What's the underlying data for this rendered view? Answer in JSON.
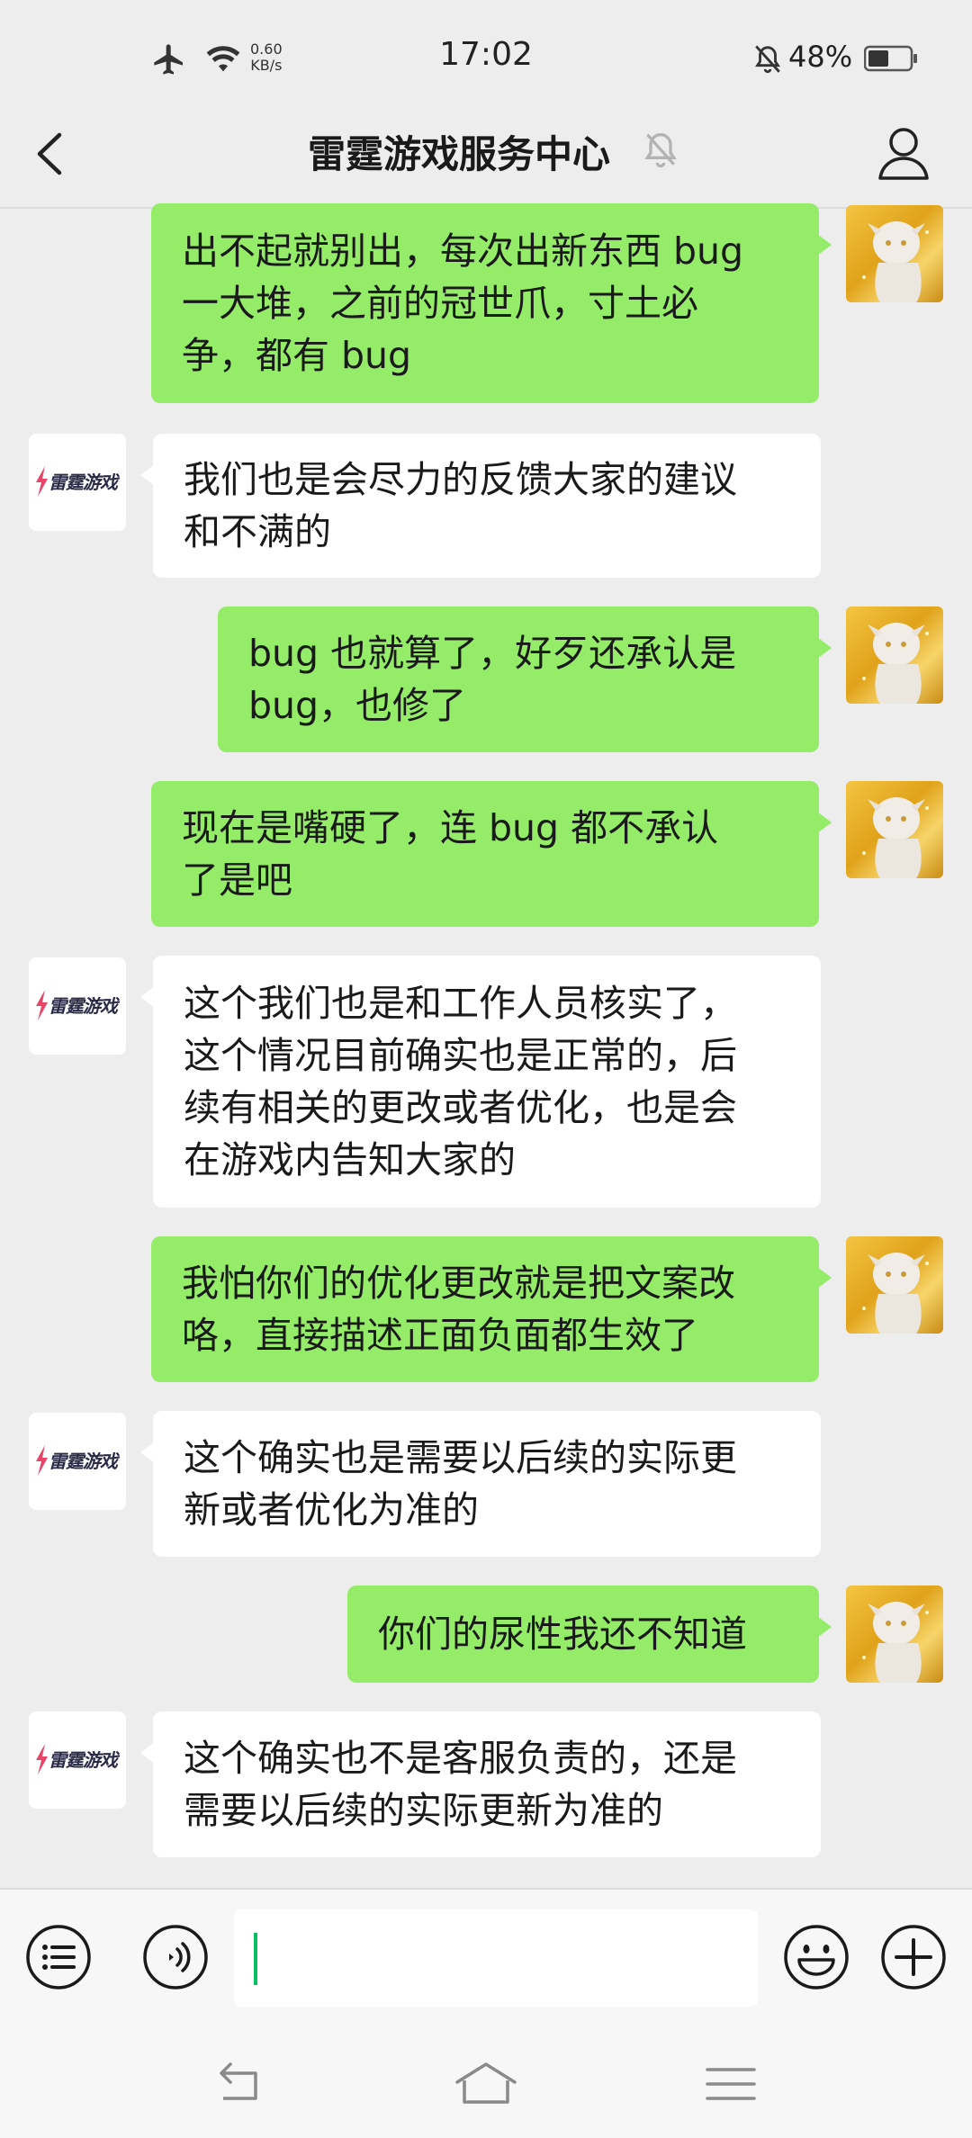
{
  "status_bar": {
    "time": "17:02",
    "net_speed_value": "0.60",
    "net_speed_unit": "KB/s",
    "battery_percent": "48%",
    "icons": [
      "airplane-icon",
      "wifi-icon",
      "mute-icon",
      "battery-icon"
    ]
  },
  "header": {
    "title": "雷霆游戏服务中心",
    "icons": [
      "back-icon",
      "notifications-muted-icon",
      "profile-icon"
    ]
  },
  "bot": {
    "logo_text": "雷霆游戏"
  },
  "messages": [
    {
      "sender": "user",
      "lines": [
        "出不起就别出，每次出新东西 bug",
        "一大堆，之前的冠世爪，寸土必",
        "争，都有 bug"
      ]
    },
    {
      "sender": "service",
      "lines": [
        "我们也是会尽力的反馈大家的建议",
        "和不满的"
      ]
    },
    {
      "sender": "user",
      "lines": [
        "bug 也就算了，好歹还承认是",
        "bug，也修了"
      ]
    },
    {
      "sender": "user",
      "lines": [
        "现在是嘴硬了，连 bug 都不承认",
        "了是吧"
      ]
    },
    {
      "sender": "service",
      "lines": [
        "这个我们也是和工作人员核实了，",
        "这个情况目前确实也是正常的，后",
        "续有相关的更改或者优化，也是会",
        "在游戏内告知大家的"
      ]
    },
    {
      "sender": "user",
      "lines": [
        "我怕你们的优化更改就是把文案改",
        "咯，直接描述正面负面都生效了"
      ]
    },
    {
      "sender": "service",
      "lines": [
        "这个确实也是需要以后续的实际更",
        "新或者优化为准的"
      ]
    },
    {
      "sender": "user",
      "lines": [
        "你们的尿性我还不知道"
      ]
    },
    {
      "sender": "service",
      "lines": [
        "这个确实也不是客服负责的，还是",
        "需要以后续的实际更新为准的"
      ]
    }
  ],
  "input_bar": {
    "text_value": "",
    "icons": [
      "menu-list-icon",
      "voice-icon",
      "emoji-icon",
      "plus-icon"
    ]
  },
  "nav_bar": {
    "icons": [
      "nav-back-icon",
      "nav-home-icon",
      "nav-menu-icon"
    ]
  },
  "colors": {
    "background": "#ededed",
    "outgoing_bubble": "#95ec69",
    "incoming_bubble": "#ffffff",
    "caret": "#07c160"
  }
}
